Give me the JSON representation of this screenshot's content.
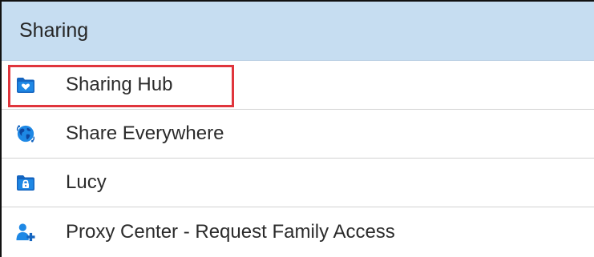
{
  "panel": {
    "title": "Sharing"
  },
  "items": [
    {
      "label": "Sharing Hub",
      "icon": "folder-heart-icon",
      "highlighted": true
    },
    {
      "label": "Share Everywhere",
      "icon": "globe-icon",
      "highlighted": false
    },
    {
      "label": "Lucy",
      "icon": "folder-lock-icon",
      "highlighted": false
    },
    {
      "label": "Proxy Center - Request Family Access",
      "icon": "person-add-icon",
      "highlighted": false
    }
  ],
  "colors": {
    "header_bg": "#c6ddf1",
    "icon_blue": "#1565c0",
    "highlight_border": "#e0353c"
  }
}
